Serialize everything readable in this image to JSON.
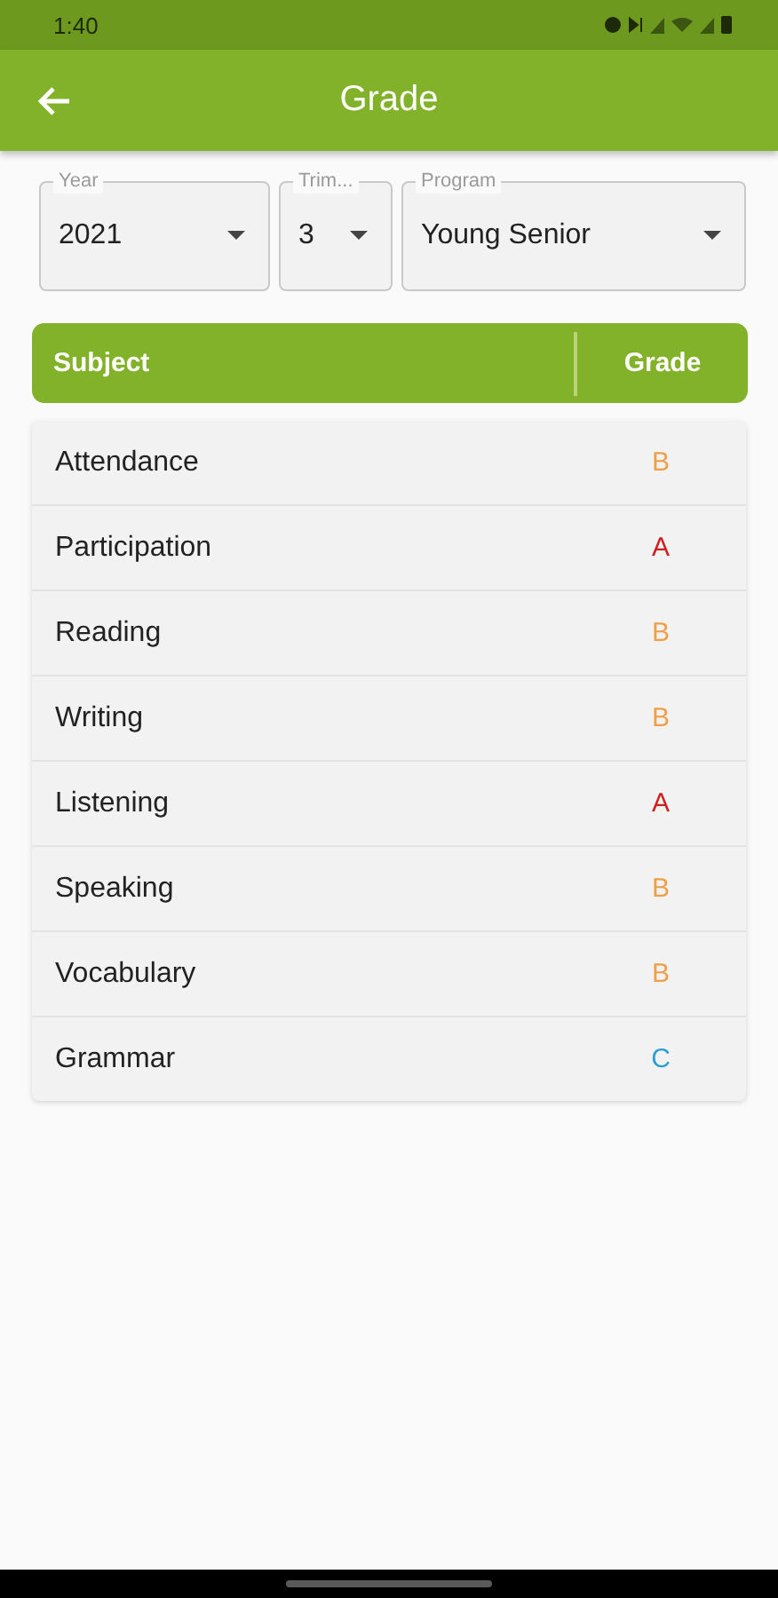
{
  "status_bar": {
    "time": "1:40"
  },
  "app_bar": {
    "title": "Grade"
  },
  "filters": [
    {
      "label": "Year",
      "value": "2021"
    },
    {
      "label": "Trim...",
      "value": "3"
    },
    {
      "label": "Program",
      "value": "Young Senior"
    }
  ],
  "table": {
    "columns": [
      "Subject",
      "Grade"
    ],
    "rows": [
      {
        "subject": "Attendance",
        "grade": "B",
        "color": "#ef9f45"
      },
      {
        "subject": "Participation",
        "grade": "A",
        "color": "#d0201c"
      },
      {
        "subject": "Reading",
        "grade": "B",
        "color": "#ef9f45"
      },
      {
        "subject": "Writing",
        "grade": "B",
        "color": "#ef9f45"
      },
      {
        "subject": "Listening",
        "grade": "A",
        "color": "#d0201c"
      },
      {
        "subject": "Speaking",
        "grade": "B",
        "color": "#ef9f45"
      },
      {
        "subject": "Vocabulary",
        "grade": "B",
        "color": "#ef9f45"
      },
      {
        "subject": "Grammar",
        "grade": "C",
        "color": "#2a9fd6"
      }
    ]
  }
}
